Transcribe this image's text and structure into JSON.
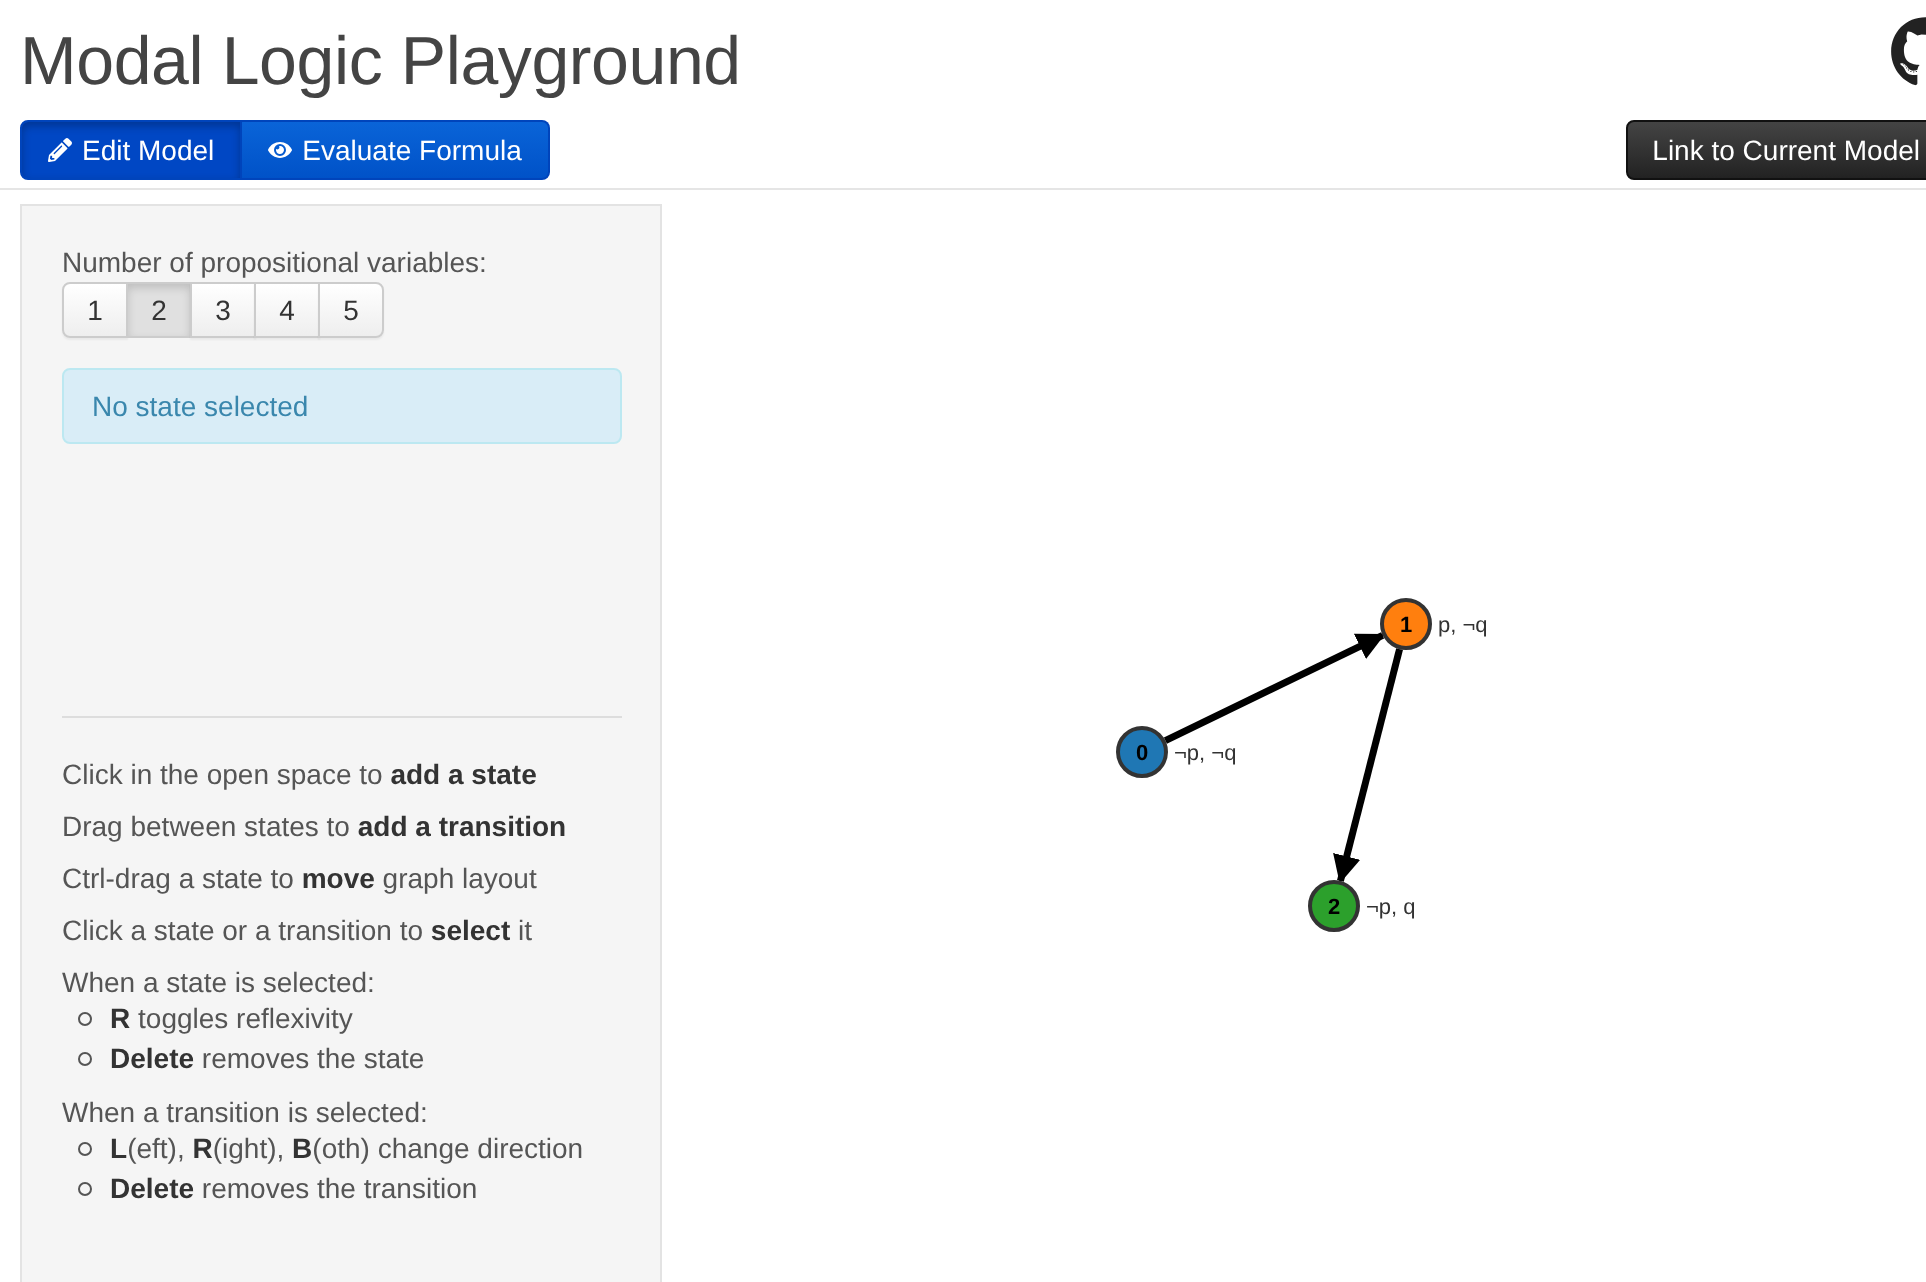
{
  "title": "Modal Logic Playground",
  "mode_tabs": [
    {
      "label": "Edit Model",
      "selected": true
    },
    {
      "label": "Evaluate Formula",
      "selected": false
    }
  ],
  "link_button": "Link to Current Model",
  "variables": {
    "label": "Number of propositional variables:",
    "options": [
      {
        "label": "1",
        "selected": false
      },
      {
        "label": "2",
        "selected": true
      },
      {
        "label": "3",
        "selected": false
      },
      {
        "label": "4",
        "selected": false
      },
      {
        "label": "5",
        "selected": false
      }
    ]
  },
  "state_info": "No state selected",
  "instructions": [
    {
      "kind": "line",
      "text": "Click in the open space to **add a state**"
    },
    {
      "kind": "line",
      "text": "Drag between states to **add a transition**"
    },
    {
      "kind": "line",
      "text": "Ctrl-drag a state to **move** graph layout"
    },
    {
      "kind": "line",
      "text": "Click a state or a transition to **select** it"
    },
    {
      "kind": "list",
      "text": "When a state is selected:",
      "items": [
        "**R** toggles reflexivity",
        "**Delete** removes the state"
      ]
    },
    {
      "kind": "list",
      "text": "When a transition is selected:",
      "items": [
        "**L**(eft), **R**(ight), **B**(oth) change direction",
        "**Delete** removes the transition"
      ]
    }
  ],
  "graph": {
    "states": [
      {
        "number": "0",
        "color": "#1f77b4",
        "label": "¬p, ¬q"
      },
      {
        "number": "1",
        "color": "#ff7f0e",
        "label": "p, ¬q"
      },
      {
        "number": "2",
        "color": "#2ca02c",
        "label": "¬p, q"
      }
    ]
  }
}
